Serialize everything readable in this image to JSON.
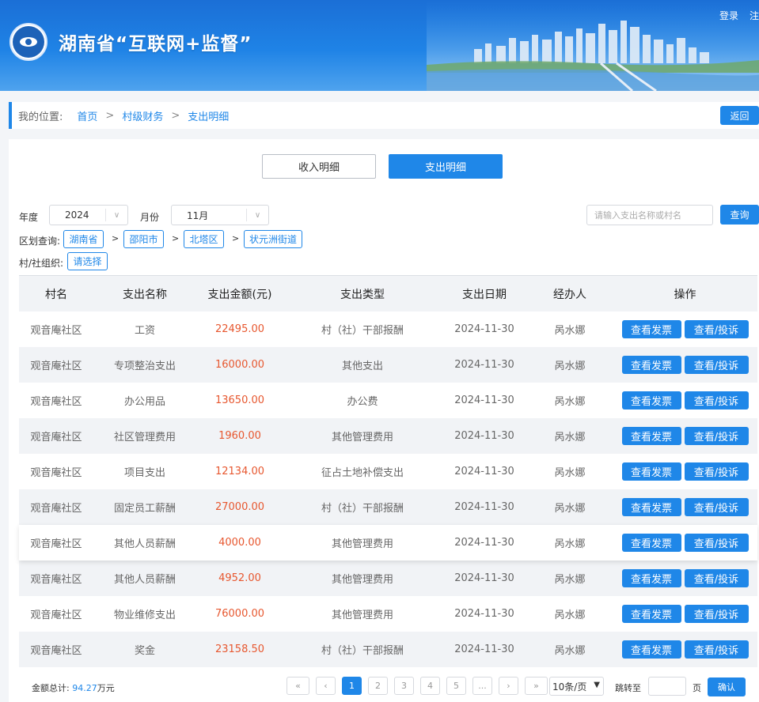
{
  "header": {
    "site_title": "湖南省“互联网+监督”",
    "login": "登录",
    "register": "注"
  },
  "breadcrumb": {
    "label": "我的位置:",
    "items": [
      "首页",
      "村级财务",
      "支出明细"
    ],
    "separator": ">",
    "back_label": "返回"
  },
  "tabs": [
    {
      "label": "收入明细",
      "active": false
    },
    {
      "label": "支出明细",
      "active": true
    }
  ],
  "filters": {
    "year_label": "年度",
    "year_value": "2024",
    "month_label": "月份",
    "month_value": "11月",
    "search_placeholder": "请输入支出名称或村名",
    "query_label": "查询",
    "region_label": "区划查询:",
    "regions": [
      "湖南省",
      "邵阳市",
      "北塔区",
      "状元洲街道"
    ],
    "region_separator": ">",
    "village_label": "村/社组织:",
    "village_button": "请选择"
  },
  "table": {
    "headers": [
      "村名",
      "支出名称",
      "支出金额(元)",
      "支出类型",
      "支出日期",
      "经办人",
      "操作"
    ],
    "actions": [
      "查看发票",
      "查看/投诉"
    ],
    "rows": [
      {
        "village": "观音庵社区",
        "name": "工资",
        "amount": "22495.00",
        "type": "村（社）干部报酬",
        "date": "2024-11-30",
        "handler": "呙水娜"
      },
      {
        "village": "观音庵社区",
        "name": "专项整治支出",
        "amount": "16000.00",
        "type": "其他支出",
        "date": "2024-11-30",
        "handler": "呙水娜"
      },
      {
        "village": "观音庵社区",
        "name": "办公用品",
        "amount": "13650.00",
        "type": "办公费",
        "date": "2024-11-30",
        "handler": "呙水娜"
      },
      {
        "village": "观音庵社区",
        "name": "社区管理费用",
        "amount": "1960.00",
        "type": "其他管理费用",
        "date": "2024-11-30",
        "handler": "呙水娜"
      },
      {
        "village": "观音庵社区",
        "name": "项目支出",
        "amount": "12134.00",
        "type": "征占土地补偿支出",
        "date": "2024-11-30",
        "handler": "呙水娜"
      },
      {
        "village": "观音庵社区",
        "name": "固定员工薪酬",
        "amount": "27000.00",
        "type": "村（社）干部报酬",
        "date": "2024-11-30",
        "handler": "呙水娜"
      },
      {
        "village": "观音庵社区",
        "name": "其他人员薪酬",
        "amount": "4000.00",
        "type": "其他管理费用",
        "date": "2024-11-30",
        "handler": "呙水娜"
      },
      {
        "village": "观音庵社区",
        "name": "其他人员薪酬",
        "amount": "4952.00",
        "type": "其他管理费用",
        "date": "2024-11-30",
        "handler": "呙水娜"
      },
      {
        "village": "观音庵社区",
        "name": "物业维修支出",
        "amount": "76000.00",
        "type": "其他管理费用",
        "date": "2024-11-30",
        "handler": "呙水娜"
      },
      {
        "village": "观音庵社区",
        "name": "奖金",
        "amount": "23158.50",
        "type": "村（社）干部报酬",
        "date": "2024-11-30",
        "handler": "呙水娜"
      }
    ]
  },
  "footer": {
    "total_label": "金额总计:",
    "total_value": "94.27",
    "total_unit": "万元",
    "pages": [
      "«",
      "‹",
      "1",
      "2",
      "3",
      "4",
      "5",
      "...",
      "›",
      "»"
    ],
    "current_page": "1",
    "page_size": "10条/页",
    "jump_label": "跳转至",
    "jump_unit": "页",
    "confirm_label": "确认"
  },
  "colors": {
    "primary": "#1f87e8",
    "amount": "#e7572f",
    "header_bg": "#1f83e6"
  }
}
